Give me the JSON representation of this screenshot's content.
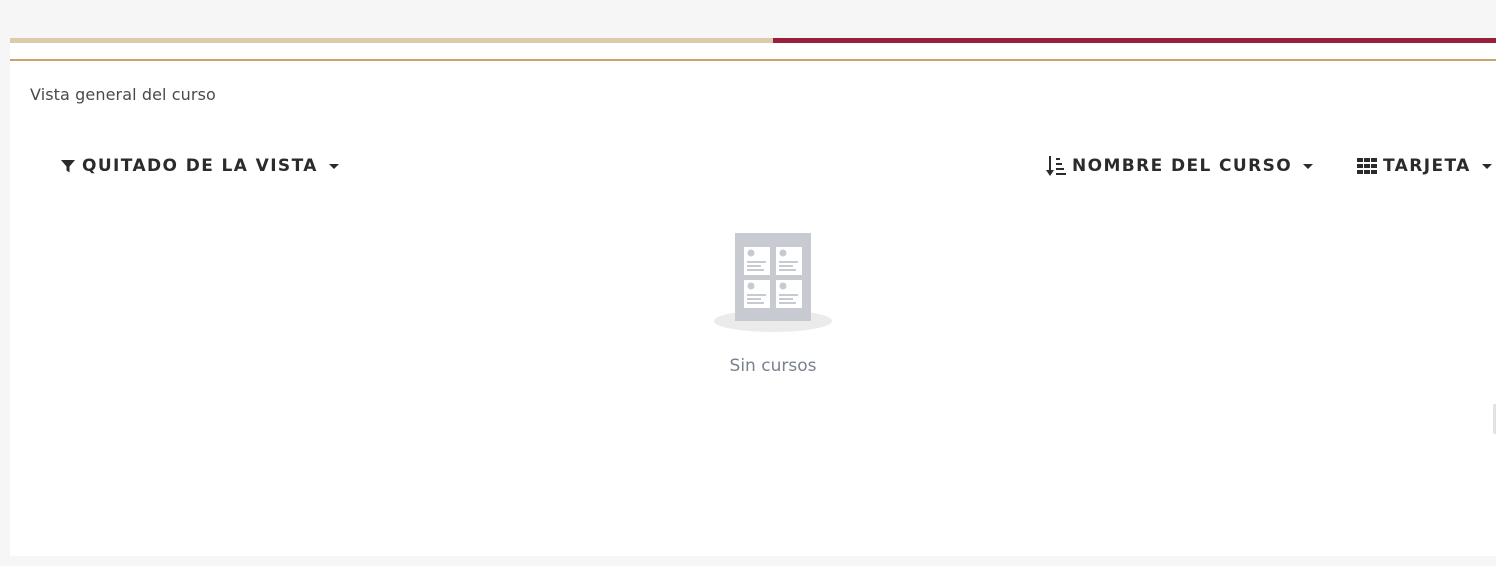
{
  "colors": {
    "accent_left": "#dccbab",
    "accent_right": "#9a1f3c",
    "card_topline": "#c8a36a"
  },
  "block": {
    "title": "Vista general del curso"
  },
  "controls": {
    "filter": {
      "icon": "filter-icon",
      "label": "QUITADO DE LA VISTA"
    },
    "sort": {
      "icon": "sort-amount-icon",
      "label": "NOMBRE DEL CURSO"
    },
    "view": {
      "icon": "grid-icon",
      "label": "TARJETA"
    }
  },
  "empty_state": {
    "icon": "courses-empty-illustration",
    "message": "Sin cursos"
  }
}
